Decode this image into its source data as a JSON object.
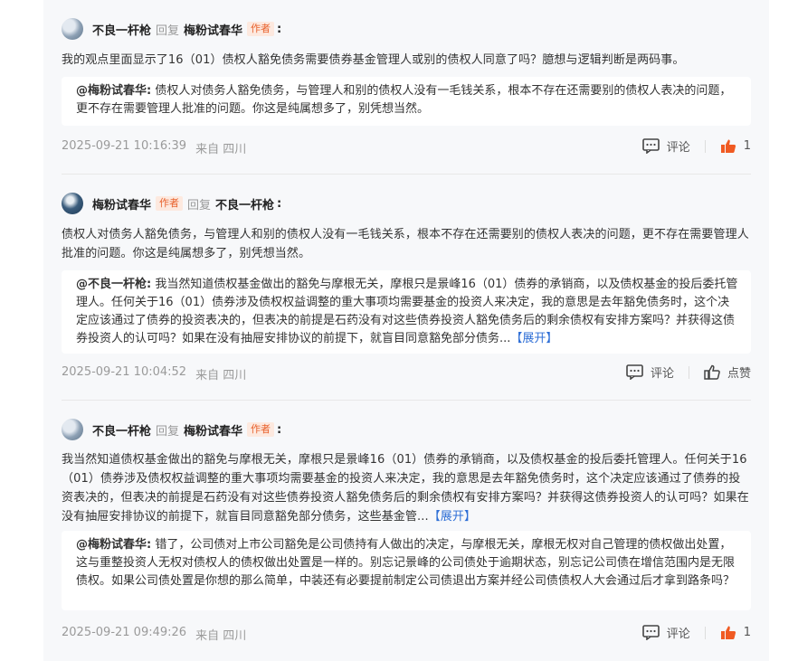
{
  "comments": [
    {
      "author": "不良一杆枪",
      "reply_word": "回复",
      "target": "梅粉试春华",
      "author_tag": "",
      "target_tag": "作者",
      "colon": ":",
      "text": "我的观点里面显示了16（01）债权人豁免债务需要债券基金管理人或别的债权人同意了吗？臆想与逻辑判断是两码事。",
      "quote_name": "@梅粉试春华:",
      "quote_text": "债权人对债务人豁免债务，与管理人和别的债权人没有一毛钱关系，根本不存在还需要别的债权人表决的问题，更不存在需要管理人批准的问题。你这是纯属想多了，别凭想当然。",
      "quote_expand": "",
      "time": "2025-09-21 10:16:39",
      "location": "来自 四川",
      "comment_label": "评论",
      "like_label": "1",
      "liked": true
    },
    {
      "author": "梅粉试春华",
      "reply_word": "回复",
      "target": "不良一杆枪",
      "author_tag": "作者",
      "target_tag": "",
      "colon": ":",
      "text": "债权人对债务人豁免债务，与管理人和别的债权人没有一毛钱关系，根本不存在还需要别的债权人表决的问题，更不存在需要管理人批准的问题。你这是纯属想多了，别凭想当然。",
      "quote_name": "@不良一杆枪:",
      "quote_text": "我当然知道债权基金做出的豁免与摩根无关，摩根只是景峰16（01）债券的承销商，以及债权基金的投后委托管理人。任何关于16（01）债券涉及债权权益调整的重大事项均需要基金的投资人来决定，我的意思是去年豁免债务时，这个决定应该通过了债券的投资表决的，但表决的前提是石药没有对这些债券投资人豁免债务后的剩余债权有安排方案吗？并获得这债券投资人的认可吗？如果在没有抽屉安排协议的前提下，就盲目同意豁免部分债务...",
      "quote_expand": "【展开】",
      "time": "2025-09-21 10:04:52",
      "location": "来自 四川",
      "comment_label": "评论",
      "like_label": "点赞",
      "liked": false
    },
    {
      "author": "不良一杆枪",
      "reply_word": "回复",
      "target": "梅粉试春华",
      "author_tag": "",
      "target_tag": "作者",
      "colon": ":",
      "text": "我当然知道债权基金做出的豁免与摩根无关，摩根只是景峰16（01）债券的承销商，以及债权基金的投后委托管理人。任何关于16（01）债券涉及债权权益调整的重大事项均需要基金的投资人来决定，我的意思是去年豁免债务时，这个决定应该通过了债券的投资表决的，但表决的前提是石药没有对这些债券投资人豁免债务后的剩余债权有安排方案吗？并获得这债券投资人的认可吗？如果在没有抽屉安排协议的前提下，就盲目同意豁免部分债务，这些基金管...",
      "text_expand": "【展开】",
      "quote_name": "@梅粉试春华:",
      "quote_text": "错了，公司债对上市公司豁免是公司债持有人做出的决定，与摩根无关，摩根无权对自己管理的债权做出处置，这与重整投资人无权对债权人的债权做出处置是一样的。别忘记景峰的公司债处于逾期状态，别忘记公司债在增信范围内是无限债权。如果公司债处置是你想的那么简单，中装还有必要提前制定公司债退出方案并经公司债债权人大会通过后才拿到路条吗？",
      "quote_expand": "",
      "time": "2025-09-21 09:49:26",
      "location": "来自 四川",
      "comment_label": "评论",
      "like_label": "1",
      "liked": true
    }
  ],
  "colors": {
    "tag_text": "#e8612c",
    "tag_bg": "#fde9df",
    "link": "#2f6fd6",
    "like_active": "#f05a22",
    "panel_bg": "#f7f8fa"
  },
  "icons": {
    "comment": "comment-bubble-icon",
    "like": "thumbs-up-icon"
  }
}
